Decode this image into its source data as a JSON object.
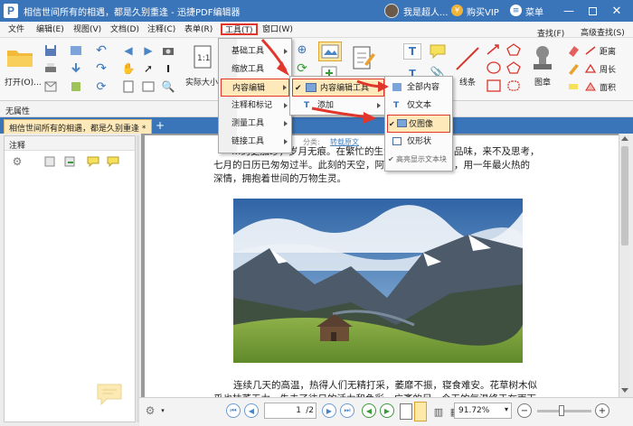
{
  "window": {
    "title": "相信世间所有的相遇，都是久别重逢 - 迅捷PDF编辑器",
    "user": "我是超人...",
    "vip": "购买VIP",
    "menu": "菜单"
  },
  "menubar": {
    "items": [
      "文件",
      "编辑(E)",
      "视图(V)",
      "文档(D)",
      "注释(C)",
      "表单(R)",
      "工具(T)",
      "窗口(W)"
    ]
  },
  "ribbon": {
    "open_label": "打开(O)...",
    "actual_size_label": "实际大小",
    "lines_label": "线条",
    "stamp_label": "图章",
    "find_label": "查找(F)",
    "advanced_find_label": "高级查找(S)",
    "distance_label": "距离",
    "perimeter_label": "周长",
    "area_label": "面积"
  },
  "propbar": {
    "label": "无属性"
  },
  "tab": {
    "label": "相信世间所有的相遇，都是久别重逢 *"
  },
  "sidepanel": {
    "title": "注释"
  },
  "tools_menu": {
    "items": [
      "基础工具",
      "缩放工具",
      "内容编辑",
      "注释和标记",
      "测量工具",
      "链接工具"
    ]
  },
  "content_edit_menu": {
    "items": [
      "内容编辑工具",
      "添加"
    ]
  },
  "content_tools_menu": {
    "items": [
      "全部内容",
      "仅文本",
      "仅图像",
      "仅形状",
      "高亮显示文本块"
    ]
  },
  "document": {
    "header_fragment": "分类:",
    "header_link": "转载原文",
    "line0": "…约更加珍，岁月无痕。在繁忙的生活",
    "line0_right": "品味，来不及思考，",
    "line1": "七月的日历已匆匆过半。此刻的天空，阿",
    "line1_right": "，用一年最火热的",
    "line2": "深情，拥抱着世间的万物生灵。",
    "line3": "连续几天的高温，热得人们无精打采，萎靡不振，寝食难安。花草树木似",
    "line4": "乎也枯萎无力，失去了往日的活力和色彩。广袤的足，今天的气温终于在雨下"
  },
  "statusbar": {
    "page_value": "1",
    "page_total": "/2",
    "zoom": "91.72%"
  }
}
